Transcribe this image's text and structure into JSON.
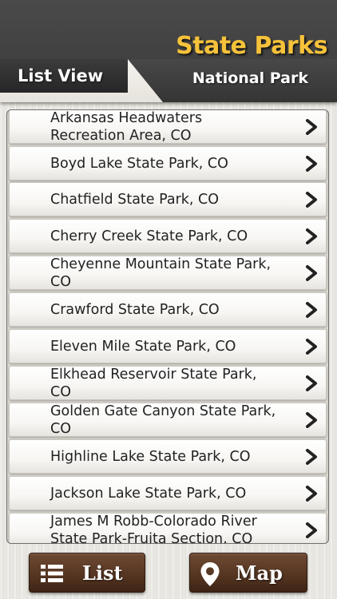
{
  "header": {
    "tab_label": "List View",
    "title": "State Parks",
    "subtitle": "National Park",
    "title_color": "#f6c23a"
  },
  "list": {
    "items": [
      "Arkansas Headwaters Recreation Area, CO",
      "Boyd Lake State Park, CO",
      "Chatfield State Park, CO",
      "Cherry Creek State Park, CO",
      "Cheyenne Mountain State Park, CO",
      "Crawford State Park, CO",
      "Eleven Mile State Park, CO",
      "Elkhead Reservoir State Park, CO",
      "Golden Gate Canyon State Park, CO",
      "Highline Lake State Park, CO",
      "Jackson Lake State Park, CO",
      "James M Robb-Colorado River State Park-Fruita Section, CO"
    ],
    "item_icon": "chevron-right-icon"
  },
  "footer": {
    "list_label": "List",
    "list_icon": "list-icon",
    "map_label": "Map",
    "map_icon": "map-pin-icon",
    "button_color": "#563622"
  }
}
